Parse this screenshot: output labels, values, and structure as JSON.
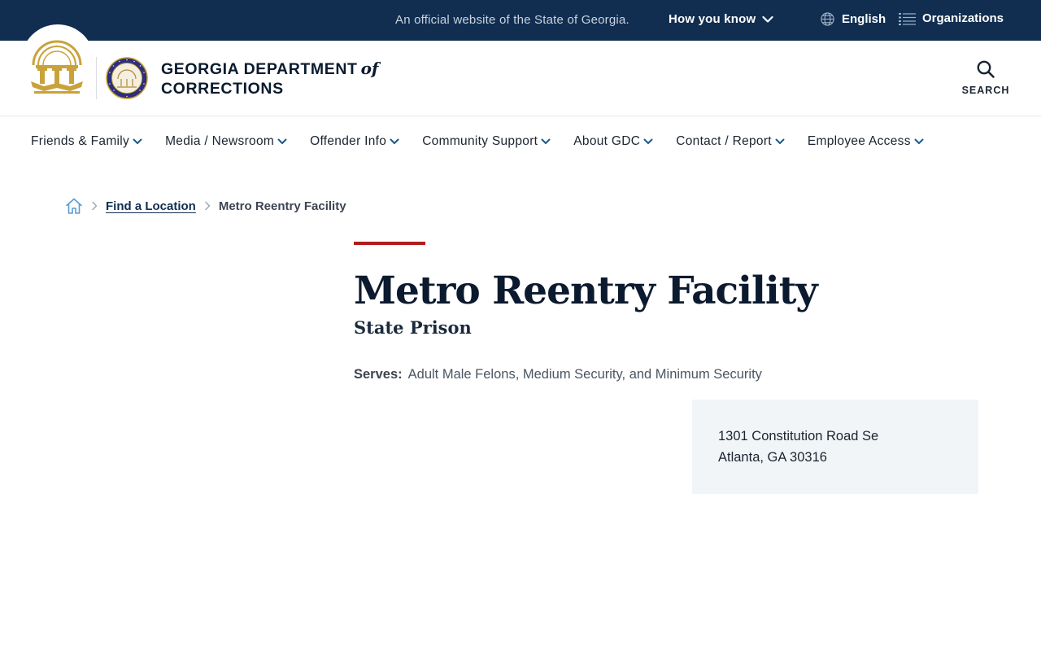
{
  "topbar": {
    "official_text": "An official website of the State of Georgia.",
    "how_you_know": "How you know",
    "language": "English",
    "organizations": "Organizations"
  },
  "header": {
    "agency_line1": "GEORGIA DEPARTMENT",
    "agency_of": "of",
    "agency_line2": "CORRECTIONS",
    "search_label": "SEARCH"
  },
  "nav": {
    "items": [
      {
        "label": "Friends & Family"
      },
      {
        "label": "Media / Newsroom"
      },
      {
        "label": "Offender Info"
      },
      {
        "label": "Community Support"
      },
      {
        "label": "About GDC"
      },
      {
        "label": "Contact / Report"
      },
      {
        "label": "Employee Access"
      }
    ]
  },
  "breadcrumb": {
    "home_icon": "home-icon",
    "link": "Find a Location",
    "current": "Metro Reentry Facility"
  },
  "page": {
    "title": "Metro Reentry Facility",
    "subtitle": "State Prison",
    "serves_label": "Serves:",
    "serves_value": "Adult Male Felons, Medium Security, and Minimum Security",
    "address_line1": "1301 Constitution Road Se",
    "address_line2": "Atlanta, GA 30316"
  },
  "colors": {
    "topbar_bg": "#112e51",
    "accent_red": "#b31b1b",
    "gold": "#c9a23a",
    "nav_chevron": "#1a5a8a",
    "address_bg": "#f2f5f8"
  }
}
